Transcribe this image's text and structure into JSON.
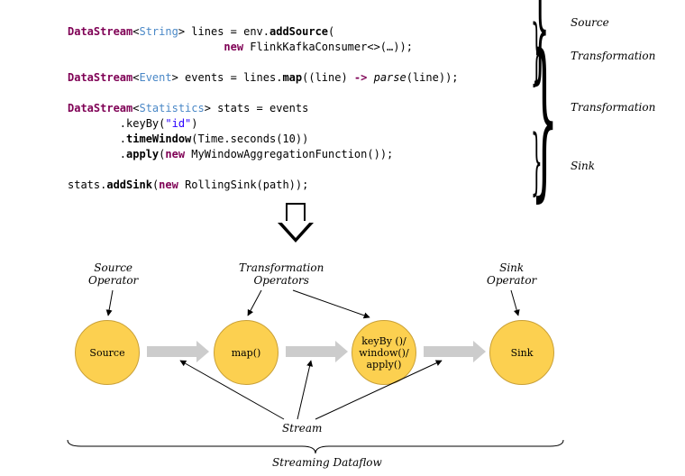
{
  "annotations": {
    "source": "Source",
    "transformation": "Transformation",
    "sink": "Sink"
  },
  "code": {
    "l1": {
      "t1": "DataStream",
      "t2": "<",
      "t3": "String",
      "t4": "> lines = env.",
      "t5": "addSource",
      "t6": "("
    },
    "l2": {
      "t1": "                        ",
      "t2": "new",
      "t3": " FlinkKafkaConsumer<>(…));"
    },
    "l3": {
      "t1": "DataStream",
      "t2": "<",
      "t3": "Event",
      "t4": "> events = lines.",
      "t5": "map",
      "t6": "((line) ",
      "t7": "->",
      "t8": " ",
      "t9": "parse",
      "t10": "(line));"
    },
    "l4": {
      "t1": "DataStream",
      "t2": "<",
      "t3": "Statistics",
      "t4": "> stats = events"
    },
    "l5": {
      "t1": "        .keyBy(",
      "t2": "\"id\"",
      "t3": ")"
    },
    "l6": {
      "t1": "        .",
      "t2": "timeWindow",
      "t3": "(Time.seconds(10))"
    },
    "l7": {
      "t1": "        .",
      "t2": "apply",
      "t3": "(",
      "t4": "new",
      "t5": " MyWindowAggregationFunction());"
    },
    "l8": {
      "t1": "stats.",
      "t2": "addSink",
      "t3": "(",
      "t4": "new",
      "t5": " RollingSink(path));"
    }
  },
  "diagram": {
    "label_source_op": "Source\nOperator",
    "label_trans_ops": "Transformation\nOperators",
    "label_sink_op": "Sink\nOperator",
    "node_source": "Source",
    "node_map": "map()",
    "node_key": "keyBy ()/\nwindow()/\napply()",
    "node_sink": "Sink",
    "label_stream": "Stream",
    "label_dataflow": "Streaming Dataflow"
  }
}
